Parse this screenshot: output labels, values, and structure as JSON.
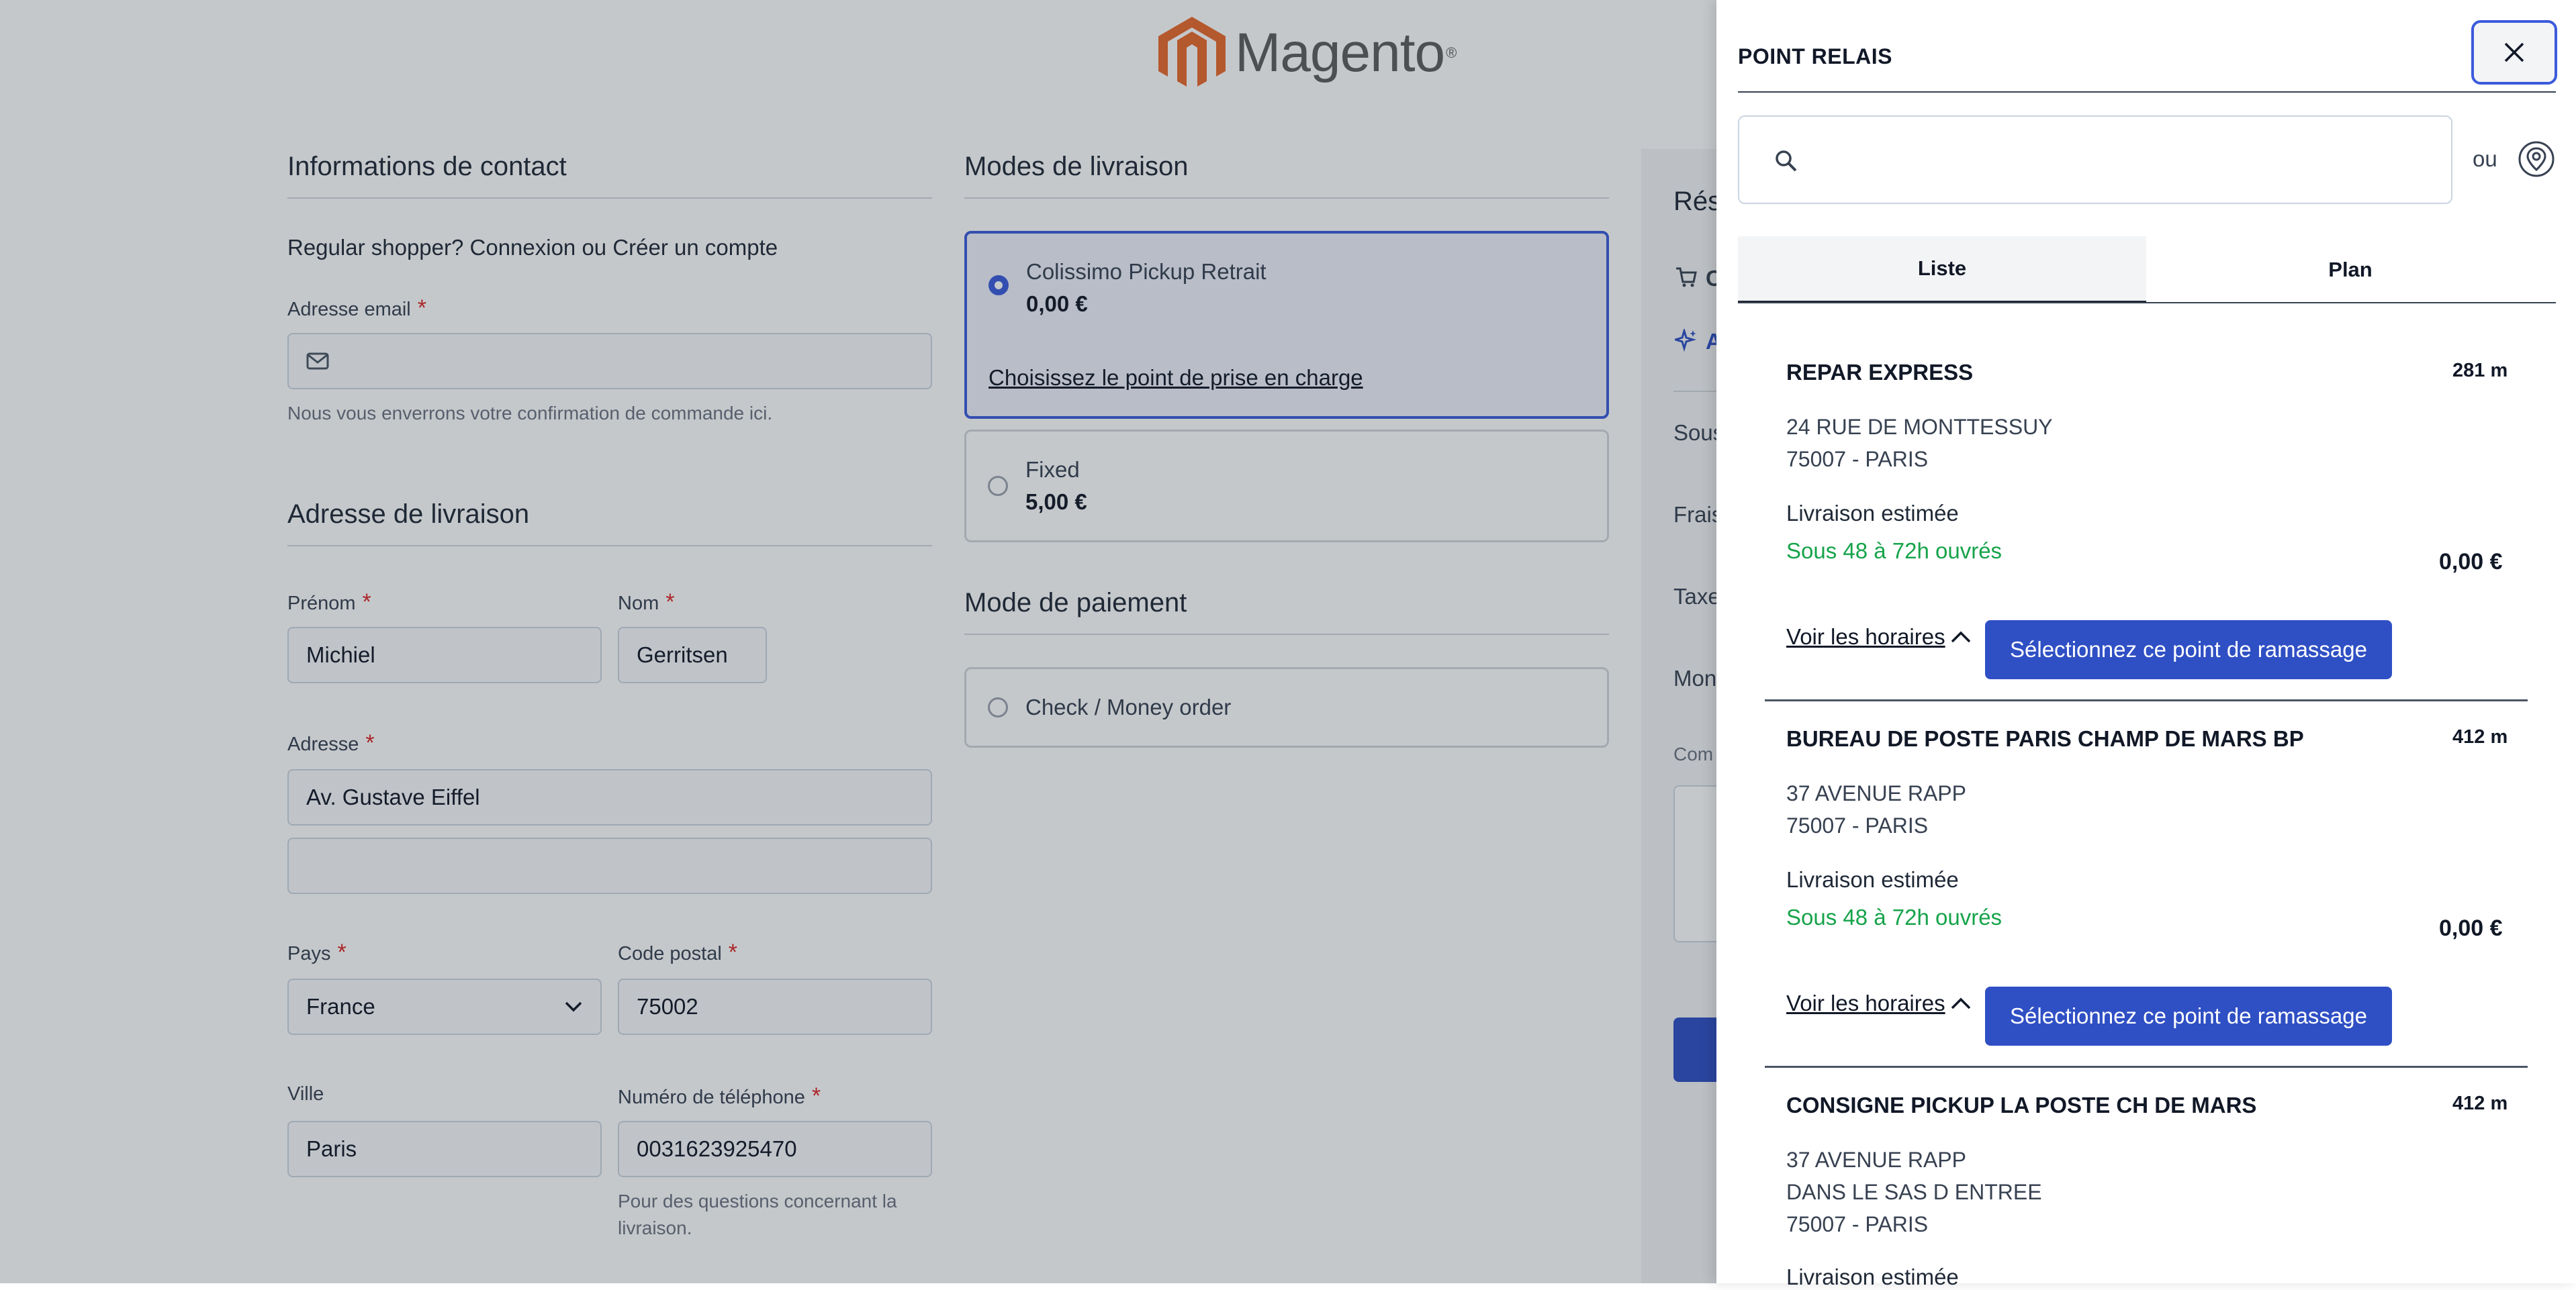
{
  "header": {
    "logo_text": "Magento",
    "logo_reg": "®"
  },
  "contact": {
    "title": "Informations de contact",
    "login_prompt": "Regular shopper? Connexion ou Créer un compte",
    "email_label": "Adresse email",
    "email_value": "",
    "email_hint": "Nous vous enverrons votre confirmation de commande ici."
  },
  "shipping_address": {
    "title": "Adresse de livraison",
    "firstname_label": "Prénom",
    "firstname_value": "Michiel",
    "lastname_label": "Nom",
    "lastname_value": "Gerritsen",
    "address_label": "Adresse",
    "address_line1": "Av. Gustave Eiffel",
    "address_line2": "",
    "country_label": "Pays",
    "country_value": "France",
    "postcode_label": "Code postal",
    "postcode_value": "75002",
    "city_label": "Ville",
    "city_value": "Paris",
    "phone_label": "Numéro de téléphone",
    "phone_value": "0031623925470",
    "phone_hint_1": "Pour des questions concernant la",
    "phone_hint_2": "livraison.",
    "required_mark": "*"
  },
  "shipping_methods": {
    "title": "Modes de livraison",
    "options": [
      {
        "title": "Colissimo Pickup Retrait",
        "price": "0,00 €",
        "link": "Choisissez le point de prise en charge",
        "selected": true
      },
      {
        "title": "Fixed",
        "price": "5,00 €",
        "selected": false
      }
    ]
  },
  "payment": {
    "title": "Mode de paiement",
    "options": [
      {
        "title": "Check / Money order",
        "selected": false
      }
    ]
  },
  "summary": {
    "title_partial": "Rés",
    "row1_partial": "C",
    "row2_partial": "A",
    "subtotal_partial": "Sous",
    "fees_partial": "Frais",
    "tax_partial": "Taxe",
    "amount_partial": "Mon",
    "comment_partial": "Com"
  },
  "drawer": {
    "title": "POINT RELAIS",
    "search_placeholder": "",
    "or_label": "ou",
    "tabs": [
      {
        "label": "Liste",
        "active": true
      },
      {
        "label": "Plan",
        "active": false
      }
    ],
    "points": [
      {
        "name": "REPAR EXPRESS",
        "distance": "281 m",
        "address": [
          "24 RUE DE MONTTESSUY",
          "75007 - PARIS"
        ],
        "delivery_label": "Livraison estimée",
        "delivery_delay": "Sous 48 à 72h ouvrés",
        "price": "0,00 €",
        "hours_link": "Voir les horaires",
        "select_label": "Sélectionnez ce point de ramassage"
      },
      {
        "name": "BUREAU DE POSTE PARIS CHAMP DE MARS BP",
        "distance": "412 m",
        "address": [
          "37 AVENUE RAPP",
          "75007 - PARIS"
        ],
        "delivery_label": "Livraison estimée",
        "delivery_delay": "Sous 48 à 72h ouvrés",
        "price": "0,00 €",
        "hours_link": "Voir les horaires",
        "select_label": "Sélectionnez ce point de ramassage"
      },
      {
        "name": "CONSIGNE PICKUP LA POSTE CH DE MARS",
        "distance": "412 m",
        "address": [
          "37 AVENUE RAPP",
          "DANS LE SAS D ENTREE",
          "75007 - PARIS"
        ],
        "delivery_label": "Livraison estimée"
      }
    ]
  },
  "colors": {
    "accent": "#2f4fc4",
    "success": "#16a34a",
    "required": "#dc2626",
    "brand": "#e8692c"
  }
}
